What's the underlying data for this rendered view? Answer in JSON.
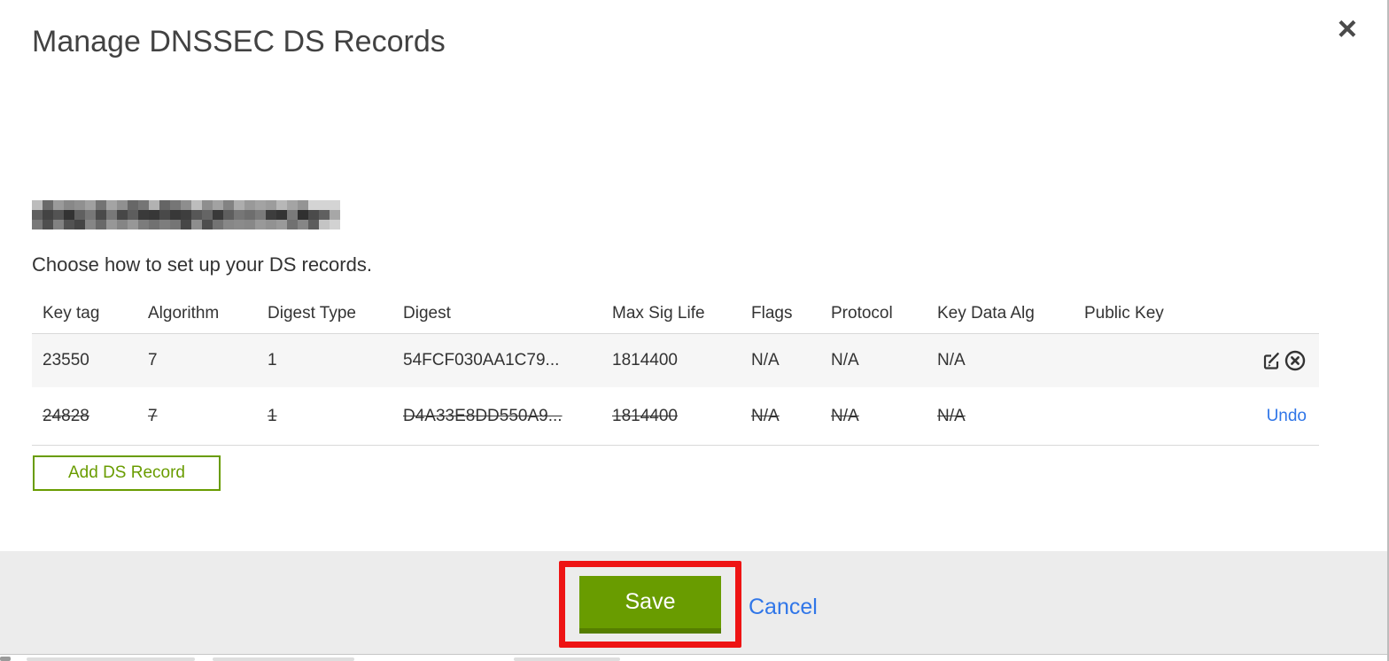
{
  "modal": {
    "title": "Manage DNSSEC DS Records",
    "subtitle": "Choose how to set up your DS records.",
    "close_glyph": "×",
    "domain_redacted": true
  },
  "table": {
    "headers": [
      "Key tag",
      "Algorithm",
      "Digest Type",
      "Digest",
      "Max Sig Life",
      "Flags",
      "Protocol",
      "Key Data Alg",
      "Public Key"
    ],
    "rows": [
      {
        "key_tag": "23550",
        "algorithm": "7",
        "digest_type": "1",
        "digest": "54FCF030AA1C79...",
        "max_sig_life": "1814400",
        "flags": "N/A",
        "protocol": "N/A",
        "key_data_alg": "N/A",
        "public_key": "",
        "state": "normal",
        "actions": [
          "edit",
          "delete"
        ]
      },
      {
        "key_tag": "24828",
        "algorithm": "7",
        "digest_type": "1",
        "digest": "D4A33E8DD550A9...",
        "max_sig_life": "1814400",
        "flags": "N/A",
        "protocol": "N/A",
        "key_data_alg": "N/A",
        "public_key": "",
        "state": "deleted",
        "undo_label": "Undo"
      }
    ]
  },
  "buttons": {
    "add_ds_record": "Add DS Record",
    "save": "Save",
    "cancel": "Cancel"
  },
  "icons": {
    "close": "x-icon",
    "edit": "edit-square-icon",
    "delete": "circle-x-icon"
  },
  "colors": {
    "accent_green": "#699c00",
    "accent_green_dark": "#557e00",
    "link_blue": "#3076e8",
    "annotation_red": "#ee1414",
    "row_alt_bg": "#f6f6f6",
    "footer_bg": "#ececec"
  }
}
